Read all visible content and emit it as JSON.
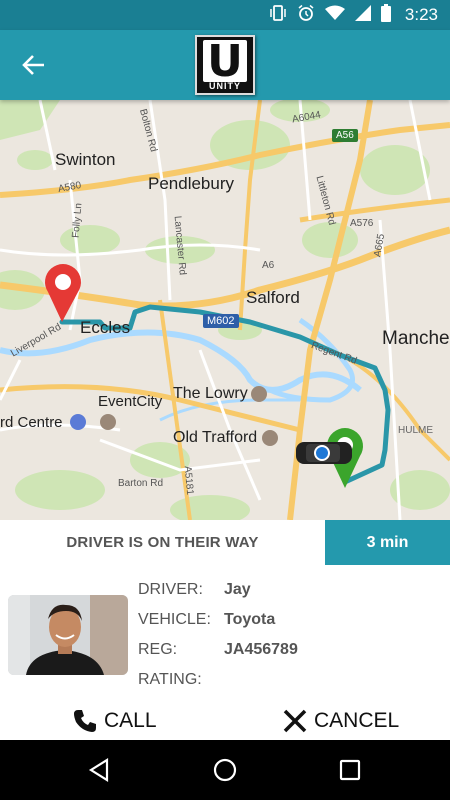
{
  "status_bar": {
    "time": "3:23"
  },
  "app_bar": {
    "logo_text": "UNITY",
    "logo_letter": "U"
  },
  "map": {
    "places": [
      {
        "name": "Swinton"
      },
      {
        "name": "Pendlebury"
      },
      {
        "name": "Salford"
      },
      {
        "name": "Eccles"
      },
      {
        "name": "Manche"
      },
      {
        "name": "EventCity"
      },
      {
        "name": "The Lowry"
      },
      {
        "name": "rd Centre"
      },
      {
        "name": "Old Trafford"
      },
      {
        "name": "HULME"
      }
    ],
    "roads": [
      "Bolton Rd",
      "Lancaster Rd",
      "Folly Ln",
      "Liverpool Rd",
      "Regent Rd",
      "Barton Rd",
      "Littleton Rd",
      "A580",
      "A6",
      "A6044",
      "A576",
      "A56",
      "A5181",
      "A665"
    ],
    "motorway": "M602",
    "primary_route": "A56",
    "route_color": "#2a96a8"
  },
  "trip": {
    "status": "DRIVER IS ON THEIR WAY",
    "eta": "3 min"
  },
  "driver": {
    "labels": {
      "driver": "DRIVER:",
      "vehicle": "VEHICLE:",
      "reg": "REG:",
      "rating": "RATING:"
    },
    "name": "Jay",
    "vehicle": "Toyota",
    "reg": "JA456789",
    "rating": ""
  },
  "actions": {
    "call": "CALL",
    "cancel": "CANCEL"
  }
}
